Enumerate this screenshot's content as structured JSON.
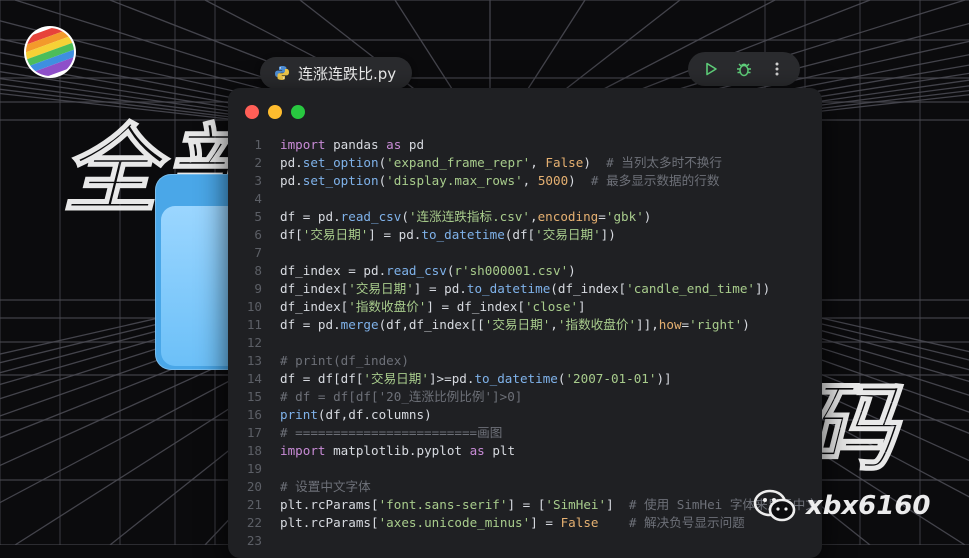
{
  "tab": {
    "filename": "连涨连跌比.py",
    "icon": "python-icon"
  },
  "toolbar": {
    "run_icon": "play-icon",
    "debug_icon": "bug-icon",
    "more_icon": "more-vertical-icon"
  },
  "background_text": {
    "left": "全部",
    "right": "码"
  },
  "watermark": {
    "text": "xbx6160",
    "icon": "wechat-icon"
  },
  "window_controls": {
    "close": "#ff5f57",
    "minimize": "#febc2e",
    "maximize": "#28c840"
  },
  "colors": {
    "background": "#0b0b0d",
    "editor": "#1f2023",
    "folder": "#4aa7e8"
  },
  "code": {
    "lines": [
      [
        [
          "kw",
          "import"
        ],
        [
          "txt",
          " pandas "
        ],
        [
          "kw",
          "as"
        ],
        [
          "txt",
          " pd"
        ]
      ],
      [
        [
          "txt",
          "pd."
        ],
        [
          "fn",
          "set_option"
        ],
        [
          "txt",
          "("
        ],
        [
          "st",
          "'expand_frame_repr'"
        ],
        [
          "txt",
          ", "
        ],
        [
          "nm",
          "False"
        ],
        [
          "txt",
          ")  "
        ],
        [
          "cm",
          "# 当列太多时不换行"
        ]
      ],
      [
        [
          "txt",
          "pd."
        ],
        [
          "fn",
          "set_option"
        ],
        [
          "txt",
          "("
        ],
        [
          "st",
          "'display.max_rows'"
        ],
        [
          "txt",
          ", "
        ],
        [
          "nm",
          "5000"
        ],
        [
          "txt",
          ")  "
        ],
        [
          "cm",
          "# 最多显示数据的行数"
        ]
      ],
      [],
      [
        [
          "txt",
          "df = pd."
        ],
        [
          "fn",
          "read_csv"
        ],
        [
          "txt",
          "("
        ],
        [
          "st",
          "'连涨连跌指标.csv'"
        ],
        [
          "txt",
          ","
        ],
        [
          "nm",
          "encoding"
        ],
        [
          "txt",
          "="
        ],
        [
          "st",
          "'gbk'"
        ],
        [
          "txt",
          ")"
        ]
      ],
      [
        [
          "txt",
          "df["
        ],
        [
          "st",
          "'交易日期'"
        ],
        [
          "txt",
          "] = pd."
        ],
        [
          "fn",
          "to_datetime"
        ],
        [
          "txt",
          "(df["
        ],
        [
          "st",
          "'交易日期'"
        ],
        [
          "txt",
          "])"
        ]
      ],
      [],
      [
        [
          "txt",
          "df_index = pd."
        ],
        [
          "fn",
          "read_csv"
        ],
        [
          "txt",
          "("
        ],
        [
          "st",
          "r'sh000001.csv'"
        ],
        [
          "txt",
          ")"
        ]
      ],
      [
        [
          "txt",
          "df_index["
        ],
        [
          "st",
          "'交易日期'"
        ],
        [
          "txt",
          "] = pd."
        ],
        [
          "fn",
          "to_datetime"
        ],
        [
          "txt",
          "(df_index["
        ],
        [
          "st",
          "'candle_end_time'"
        ],
        [
          "txt",
          "])"
        ]
      ],
      [
        [
          "txt",
          "df_index["
        ],
        [
          "st",
          "'指数收盘价'"
        ],
        [
          "txt",
          "] = df_index["
        ],
        [
          "st",
          "'close'"
        ],
        [
          "txt",
          "]"
        ]
      ],
      [
        [
          "txt",
          "df = pd."
        ],
        [
          "fn",
          "merge"
        ],
        [
          "txt",
          "(df,df_index[["
        ],
        [
          "st",
          "'交易日期'"
        ],
        [
          "txt",
          ","
        ],
        [
          "st",
          "'指数收盘价'"
        ],
        [
          "txt",
          "]],"
        ],
        [
          "nm",
          "how"
        ],
        [
          "txt",
          "="
        ],
        [
          "st",
          "'right'"
        ],
        [
          "txt",
          ")"
        ]
      ],
      [],
      [
        [
          "cm",
          "# print(df_index)"
        ]
      ],
      [
        [
          "txt",
          "df = df[df["
        ],
        [
          "st",
          "'交易日期'"
        ],
        [
          "txt",
          "]>=pd."
        ],
        [
          "fn",
          "to_datetime"
        ],
        [
          "txt",
          "("
        ],
        [
          "st",
          "'2007-01-01'"
        ],
        [
          "txt",
          ")]"
        ]
      ],
      [
        [
          "cm",
          "# df = df[df['20_连涨比例比例']>0]"
        ]
      ],
      [
        [
          "fn",
          "print"
        ],
        [
          "txt",
          "(df,df.columns)"
        ]
      ],
      [
        [
          "cm",
          "# ========================画图"
        ]
      ],
      [
        [
          "kw",
          "import"
        ],
        [
          "txt",
          " matplotlib.pyplot "
        ],
        [
          "kw",
          "as"
        ],
        [
          "txt",
          " plt"
        ]
      ],
      [],
      [
        [
          "cm",
          "# 设置中文字体"
        ]
      ],
      [
        [
          "txt",
          "plt.rcParams["
        ],
        [
          "st",
          "'font.sans-serif'"
        ],
        [
          "txt",
          "] = ["
        ],
        [
          "st",
          "'SimHei'"
        ],
        [
          "txt",
          "]  "
        ],
        [
          "cm",
          "# 使用 SimHei 字体来显示中文"
        ]
      ],
      [
        [
          "txt",
          "plt.rcParams["
        ],
        [
          "st",
          "'axes.unicode_minus'"
        ],
        [
          "txt",
          "] = "
        ],
        [
          "nm",
          "False"
        ],
        [
          "txt",
          "    "
        ],
        [
          "cm",
          "# 解决负号显示问题"
        ]
      ],
      []
    ]
  }
}
